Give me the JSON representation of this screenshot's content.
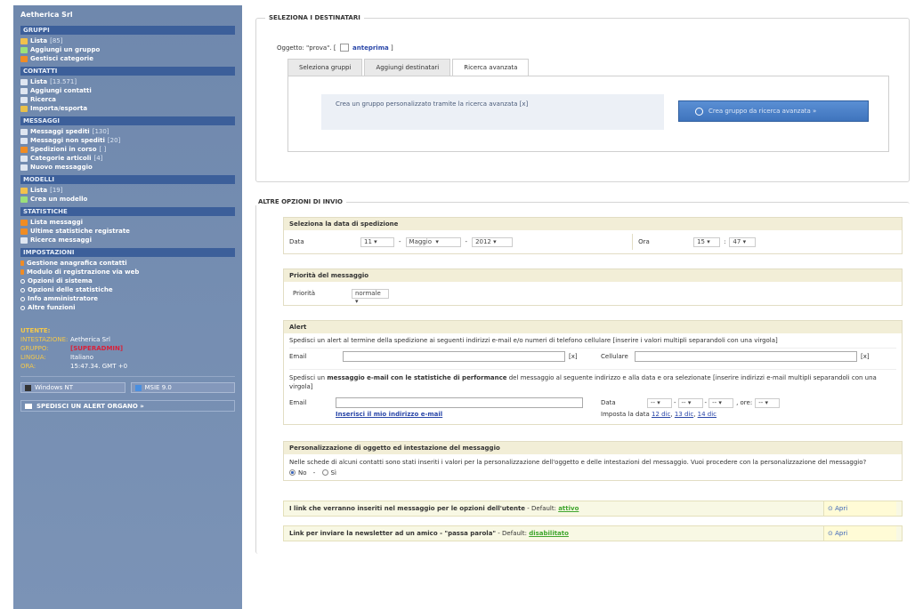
{
  "sidebar": {
    "brand": "Aetherica Srl",
    "sections": [
      {
        "title": "GRUPPI",
        "items": [
          {
            "label": "Lista",
            "count": "[85]",
            "icon": "group-icon",
            "color": "#f2c14c"
          },
          {
            "label": "Aggiungi un gruppo",
            "icon": "add-group-icon",
            "color": "#9be07a"
          },
          {
            "label": "Gestisci categorie",
            "icon": "categories-icon",
            "color": "#f08c24"
          }
        ]
      },
      {
        "title": "CONTATTI",
        "items": [
          {
            "label": "Lista",
            "count": "[13.571]",
            "icon": "contacts-icon",
            "color": "#dfe6f1"
          },
          {
            "label": "Aggiungi contatti",
            "icon": "add-contacts-icon",
            "color": "#dfe6f1"
          },
          {
            "label": "Ricerca",
            "icon": "search-icon",
            "color": "#dfe6f1"
          },
          {
            "label": "Importa/esporta",
            "icon": "import-export-icon",
            "color": "#e8c04a"
          }
        ]
      },
      {
        "title": "MESSAGGI",
        "items": [
          {
            "label": "Messaggi spediti",
            "count": "[130]",
            "icon": "sent-messages-icon",
            "color": "#dfe6f1"
          },
          {
            "label": "Messaggi non spediti",
            "count": "[20]",
            "icon": "unsent-messages-icon",
            "color": "#dfe6f1"
          },
          {
            "label": "Spedizioni in corso",
            "count": "[ ]",
            "icon": "sending-icon",
            "color": "#f08c24"
          },
          {
            "label": "Categorie articoli",
            "count": "[4]",
            "icon": "article-categories-icon",
            "color": "#dfe6f1"
          },
          {
            "label": "Nuovo messaggio",
            "icon": "new-message-icon",
            "color": "#dfe6f1"
          }
        ]
      },
      {
        "title": "MODELLI",
        "items": [
          {
            "label": "Lista",
            "count": "[19]",
            "icon": "templates-icon",
            "color": "#f2c14c"
          },
          {
            "label": "Crea un modello",
            "icon": "new-template-icon",
            "color": "#9be07a"
          }
        ]
      },
      {
        "title": "STATISTICHE",
        "items": [
          {
            "label": "Lista messaggi",
            "icon": "stats-list-icon",
            "color": "#f08c24"
          },
          {
            "label": "Ultime statistiche registrate",
            "icon": "latest-stats-icon",
            "color": "#f08c24"
          },
          {
            "label": "Ricerca messaggi",
            "icon": "search-messages-icon",
            "color": "#dfe6f1"
          }
        ]
      },
      {
        "title": "IMPOSTAZIONI",
        "items": [
          {
            "label": "Gestione anagrafica contatti",
            "style": "orange"
          },
          {
            "label": "Modulo di registrazione via web",
            "style": "orange"
          },
          {
            "label": "Opzioni di sistema",
            "style": "bullet"
          },
          {
            "label": "Opzioni delle statistiche",
            "style": "bullet"
          },
          {
            "label": "Info amministratore",
            "style": "bullet"
          },
          {
            "label": "Altre funzioni",
            "style": "bullet"
          }
        ]
      }
    ],
    "user": {
      "title": "UTENTE:",
      "rows": [
        {
          "k": "INTESTAZIONE:",
          "v": "Aetherica Srl",
          "red": false
        },
        {
          "k": "GRUPPO:",
          "v": "[SUPERADMIN]",
          "red": true
        },
        {
          "k": "LINGUA:",
          "v": "Italiano",
          "red": false
        },
        {
          "k": "ORA:",
          "v": "15:47.34. GMT +0",
          "red": false
        }
      ]
    },
    "os": [
      {
        "label": "Windows NT",
        "icon": "windows-icon"
      },
      {
        "label": "MSIE 9.0",
        "icon": "browser-icon"
      }
    ],
    "alert_button": "SPEDISCI UN ALERT ORGANO »"
  },
  "main": {
    "select_section": {
      "legend": "SELEZIONA I DESTINATARI",
      "subject_prefix": "Oggetto: \"prova\". [",
      "preview_link": "anteprima",
      "subject_suffix": "]",
      "tabs": [
        "Seleziona gruppi",
        "Aggiungi destinatari",
        "Ricerca avanzata"
      ],
      "active_tab": 2,
      "info_text": "Crea un gruppo personalizzato tramite la ricerca avanzata  [x]",
      "create_button": "Crea gruppo da ricerca avanzata »"
    },
    "options_section": {
      "legend": "ALTRE OPZIONI DI INVIO",
      "date_box": {
        "title": "Seleziona la data di spedizione",
        "date_label": "Data",
        "day": "11",
        "month": "Maggio",
        "year": "2012",
        "time_label": "Ora",
        "hour": "15",
        "minute": "47"
      },
      "priority_box": {
        "title": "Priorità del messaggio",
        "label": "Priorità",
        "value": "normale"
      },
      "alert_box": {
        "title": "Alert",
        "desc1": "Spedisci un alert al termine della spedizione ai seguenti indirizzi e-mail e/o numeri di telefono cellulare [inserire i valori multipli separandoli con una virgola]",
        "email_label": "Email",
        "x_label": "[x]",
        "cell_label": "Cellulare",
        "desc2_a": "Spedisci un ",
        "desc2_b": "messaggio e-mail con le statistiche di performance",
        "desc2_c": " del messaggio al seguente indirizzo e alla data e ora selezionate [inserire indirizzi e-mail multipli separandoli con una virgola]",
        "email2_label": "Email",
        "insert_link": "Inserisci il mio indirizzo e-mail",
        "data_label": "Data",
        "placeholder_sel": "--",
        "ore_label": ", ore:",
        "set_date_prefix": "Imposta la data",
        "set_date_links": [
          "12 dic",
          "13 dic",
          "14 dic"
        ]
      },
      "personalize_box": {
        "title": "Personalizzazione di oggetto ed intestazione del messaggio",
        "text": "Nelle schede di alcuni contatti sono stati inseriti i valori per la personalizzazione dell'oggetto e delle intestazioni del messaggio. Vuoi procedere con la personalizzazione del messaggio?",
        "opt_no": "No",
        "opt_si": "Sì"
      },
      "collapsibles": [
        {
          "text": "I link che verranno inseriti nel messaggio per le opzioni dell'utente",
          "default_prefix": " - Default: ",
          "default_value": "attivo",
          "button": "Apri"
        },
        {
          "text": "Link per inviare la newsletter ad un amico - \"passa parola\"",
          "default_prefix": " - Default: ",
          "default_value": "disabilitato",
          "button": "Apri"
        }
      ]
    }
  }
}
